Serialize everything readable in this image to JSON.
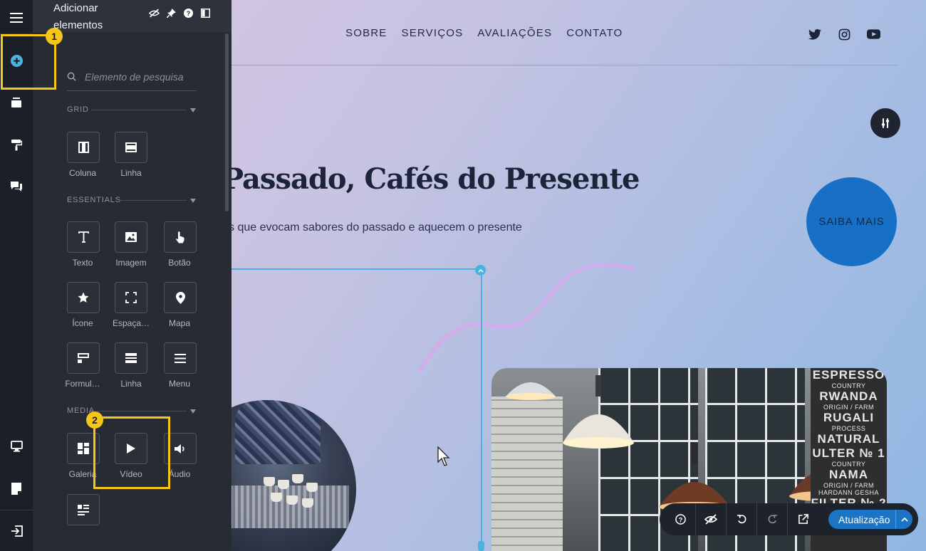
{
  "panel": {
    "title": "Adicionar elementos",
    "search_placeholder": "Elemento de pesquisa",
    "sections": {
      "grid": "GRID",
      "essentials": "ESSENTIALS",
      "media": "MEDIA"
    },
    "items": {
      "coluna": "Coluna",
      "linha": "Linha",
      "texto": "Texto",
      "imagem": "Imagem",
      "botao": "Botão",
      "icone": "Ícone",
      "espacador": "Espaça…",
      "mapa": "Mapa",
      "formulario": "Formul…",
      "linha2": "Linha",
      "menu": "Menu",
      "galeria": "Galeria",
      "video": "Vídeo",
      "audio": "Áudio"
    }
  },
  "badges": {
    "first": "1",
    "second": "2"
  },
  "site": {
    "nav": [
      "SOBRE",
      "SERVIÇOS",
      "AVALIAÇÕES",
      "CONTATO"
    ],
    "hero_title": "Passado, Cafés do Presente",
    "hero_subtitle": "s que evocam sabores do passado e aquecem o presente",
    "cta": "SAIBA MAIS",
    "menu_board": [
      "ESPRESSO",
      "COUNTRY",
      "RWANDA",
      "ORIGIN / FARM",
      "RUGALI",
      "PROCESS",
      "NATURAL",
      "ULTER № 1",
      "COUNTRY",
      "NAMA",
      "ORIGIN / FARM",
      "HARDANN GESHA",
      "FILTER № 2"
    ]
  },
  "toolbar": {
    "update_label": "Atualização"
  },
  "colors": {
    "highlight": "#f5c518",
    "accent_blue": "#1e74c4",
    "selection": "#4ab3df",
    "panel_bg": "#272b33",
    "rail_bg": "#1b1f27"
  },
  "icons": {
    "rail": [
      "hamburger-icon",
      "add-circle-icon",
      "layers-icon",
      "paint-roller-icon",
      "comments-icon",
      "desktop-icon",
      "page-icon",
      "exit-icon"
    ],
    "toolbar": [
      "help-icon",
      "eye-slash-icon",
      "undo-icon",
      "redo-icon",
      "external-link-icon",
      "chevron-up-icon"
    ],
    "social": [
      "twitter-icon",
      "instagram-icon",
      "youtube-icon"
    ]
  }
}
